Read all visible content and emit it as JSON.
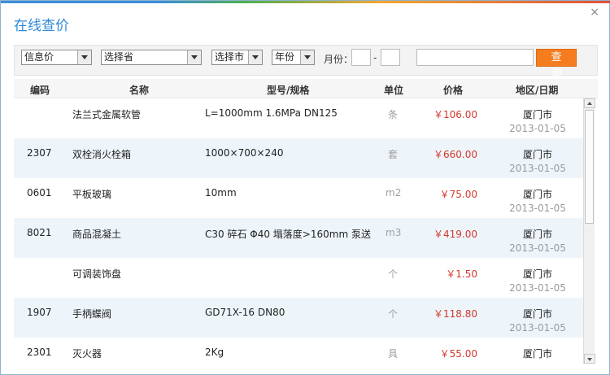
{
  "dialog": {
    "title": "在线查价",
    "close_icon": "close-icon"
  },
  "filters": {
    "info_type": "信息价",
    "province": "选择省",
    "city": "选择市",
    "year": "年份",
    "month_label": "月份：",
    "month_separator": "-",
    "month_from": "",
    "month_to": "",
    "keyword": "",
    "query_label": "查 询"
  },
  "columns": [
    "编码",
    "名称",
    "型号/规格",
    "单位",
    "价格",
    "地区/日期"
  ],
  "rows": [
    {
      "code": "",
      "name": "法兰式金属软管",
      "spec": "L=1000mm 1.6MPa DN125",
      "unit": "条",
      "price": "￥106.00",
      "city": "厦门市",
      "date": "2013-01-05"
    },
    {
      "code": "2307",
      "name": "双栓消火栓箱",
      "spec": "1000×700×240",
      "unit": "套",
      "price": "￥660.00",
      "city": "厦门市",
      "date": "2013-01-05"
    },
    {
      "code": "0601",
      "name": "平板玻璃",
      "spec": "10mm",
      "unit": "m2",
      "price": "￥75.00",
      "city": "厦门市",
      "date": "2013-01-05"
    },
    {
      "code": "8021",
      "name": "商品混凝土",
      "spec": "C30 碎石 Φ40 塌落度>160mm 泵送",
      "unit": "m3",
      "price": "￥419.00",
      "city": "厦门市",
      "date": "2013-01-05"
    },
    {
      "code": "",
      "name": "可调装饰盘",
      "spec": "",
      "unit": "个",
      "price": "￥1.50",
      "city": "厦门市",
      "date": "2013-01-05"
    },
    {
      "code": "1907",
      "name": "手柄蝶阀",
      "spec": "GD71X-16 DN80",
      "unit": "个",
      "price": "￥118.80",
      "city": "厦门市",
      "date": "2013-01-05"
    },
    {
      "code": "2301",
      "name": "灭火器",
      "spec": "2Kg",
      "unit": "具",
      "price": "￥55.00",
      "city": "厦门市",
      "date": ""
    }
  ],
  "colors": {
    "title": "#2f8ad8",
    "price": "#d4382c",
    "query_button": "#f57c1f",
    "alt_row": "#eef5fa"
  }
}
